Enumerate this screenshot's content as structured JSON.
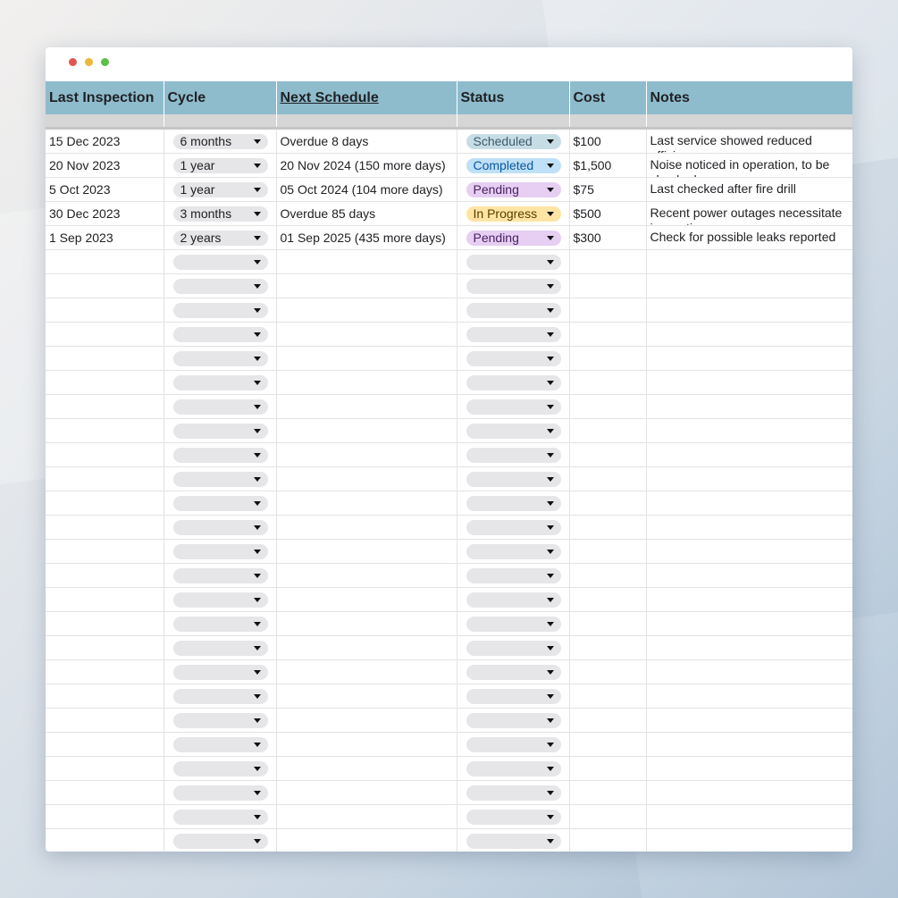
{
  "window": {
    "controls": [
      "close",
      "minimize",
      "maximize"
    ]
  },
  "table": {
    "headers": {
      "last_inspection": "Last Inspection",
      "cycle": "Cycle",
      "next_schedule": "Next Schedule",
      "status": "Status",
      "cost": "Cost",
      "notes": "Notes"
    },
    "rows": [
      {
        "last_inspection": "15 Dec 2023",
        "cycle": "6 months",
        "next_schedule": "Overdue 8 days",
        "status": "Scheduled",
        "cost": "$100",
        "notes": "Last service showed reduced efficiency"
      },
      {
        "last_inspection": "20 Nov 2023",
        "cycle": "1 year",
        "next_schedule": "20 Nov 2024 (150 more days)",
        "status": "Completed",
        "cost": "$1,500",
        "notes": "Noise noticed in operation, to be checked"
      },
      {
        "last_inspection": "5 Oct 2023",
        "cycle": "1 year",
        "next_schedule": "05 Oct 2024 (104 more days)",
        "status": "Pending",
        "cost": "$75",
        "notes": "Last checked after fire drill"
      },
      {
        "last_inspection": "30 Dec 2023",
        "cycle": "3 months",
        "next_schedule": "Overdue 85 days",
        "status": "In Progress",
        "cost": "$500",
        "notes": "Recent power outages necessitate inspection"
      },
      {
        "last_inspection": "1 Sep 2023",
        "cycle": "2 years",
        "next_schedule": "01 Sep 2025 (435 more days)",
        "status": "Pending",
        "cost": "$300",
        "notes": "Check for possible leaks reported"
      }
    ],
    "empty_row_count": 25
  },
  "colors": {
    "header_bg": "#8fbccd",
    "chip_default": "#e6e6e9",
    "status": {
      "Scheduled": {
        "bg": "#c7dde6",
        "fg": "#3c5c6a"
      },
      "Completed": {
        "bg": "#bfe0f6",
        "fg": "#0b57a3"
      },
      "Pending": {
        "bg": "#e6cff2",
        "fg": "#4a2163"
      },
      "In Progress": {
        "bg": "#ffe4a3",
        "fg": "#5c3d00"
      }
    }
  }
}
